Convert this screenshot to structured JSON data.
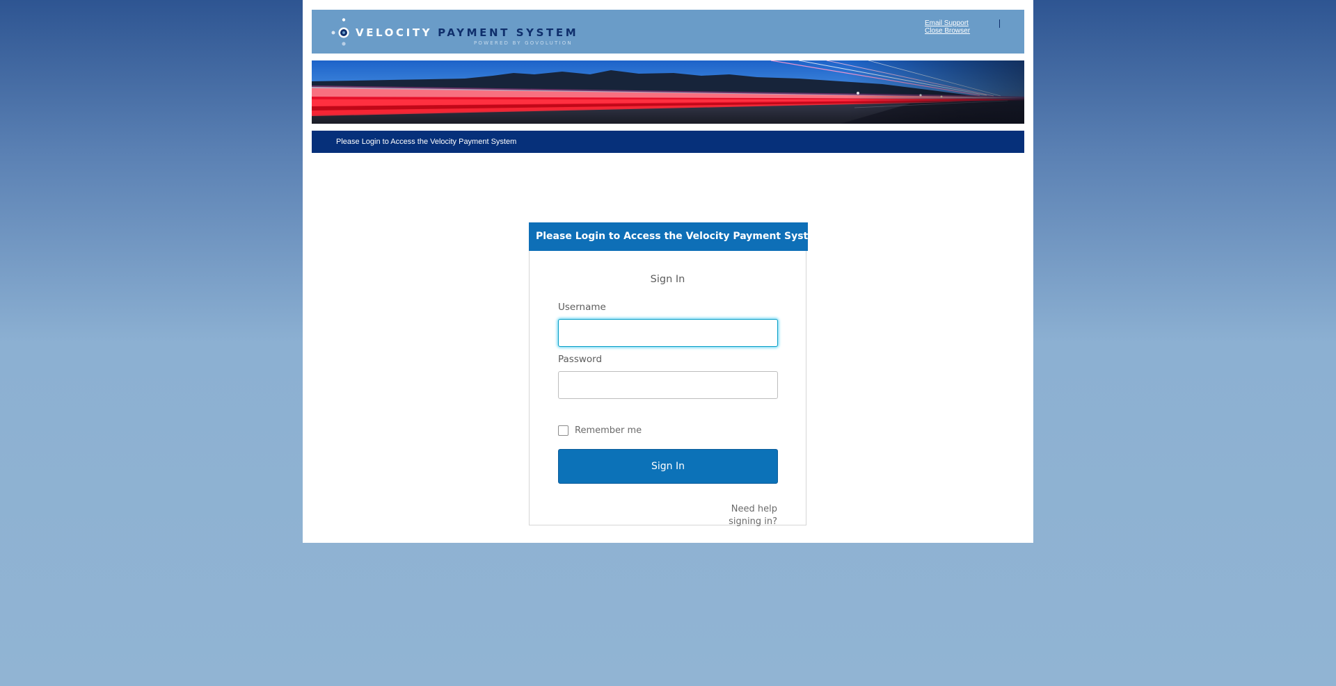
{
  "header": {
    "logo": {
      "word1": "VELOCITY",
      "word2": "PAYMENT SYSTEM",
      "tagline": "POWERED BY GOVOLUTION"
    },
    "links": {
      "email_support": "Email Support",
      "close_browser": "Close Browser"
    }
  },
  "nav": {
    "message": "Please Login to Access the Velocity Payment System"
  },
  "login": {
    "header": "Please Login to Access the Velocity Payment System",
    "title": "Sign In",
    "username_label": "Username",
    "username_value": "",
    "password_label": "Password",
    "password_value": "",
    "remember_label": "Remember me",
    "remember_checked": false,
    "submit_label": "Sign In",
    "help_line1": "Need help",
    "help_line2": "signing in?"
  },
  "colors": {
    "background_top": "#2e5592",
    "background_bottom": "#91b4d3",
    "header_bar": "#6a9cc8",
    "nav_bar": "#06307a",
    "login_header": "#0e6fb7",
    "button": "#0c72b8",
    "focus_ring": "#5ad2f2"
  },
  "icons": {
    "logo_mark": "velocity-dots-icon",
    "checkbox": "checkbox-unchecked"
  }
}
